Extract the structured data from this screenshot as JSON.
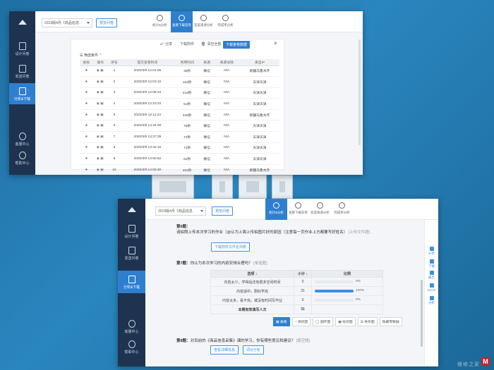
{
  "window1": {
    "sidebar": [
      {
        "label": "",
        "icon": "home-icon"
      },
      {
        "label": "设计问卷",
        "icon": "edit-document-icon"
      },
      {
        "label": "发送问卷",
        "icon": "send-document-icon"
      },
      {
        "label": "分析&下载",
        "icon": "analysis-icon",
        "active": true
      },
      {
        "label": "客服中心",
        "icon": "headset-icon"
      },
      {
        "label": "帮助中心",
        "icon": "help-icon"
      }
    ],
    "survey_select": "2019版4月《商品信息",
    "preview_label": "预览问卷",
    "tabs": [
      {
        "label": "统计&分析",
        "icon": "chart-pie-icon"
      },
      {
        "label": "查看下载答卷",
        "icon": "download-icon",
        "active": true
      },
      {
        "label": "答案来源分析",
        "icon": "source-icon"
      },
      {
        "label": "完成率分析",
        "icon": "check-circle-icon"
      }
    ],
    "toolbar": {
      "share": "分享",
      "download_attachment": "下载附件",
      "clear_all": "清空全部",
      "download_data": "下载答卷数据"
    },
    "filter_label": "筛选条件",
    "columns": [
      "星标",
      "操作",
      "序号",
      "提交答卷时间",
      "所用时间",
      "来源",
      "来源详情",
      "来自IP"
    ],
    "rows": [
      {
        "no": "1",
        "time": "2020/3/9 12:01:06",
        "dur": "36秒",
        "src": "微信",
        "detail": "N/A",
        "ip": "新疆乌鲁木齐"
      },
      {
        "no": "2",
        "time": "2020/3/9 12:03:10",
        "dur": "154秒",
        "src": "微信",
        "detail": "N/A",
        "ip": "天津天津"
      },
      {
        "no": "3",
        "time": "2020/3/9 12:08:34",
        "dur": "216秒",
        "src": "微信",
        "detail": "N/A",
        "ip": "天津天津"
      },
      {
        "no": "4",
        "time": "2020/3/9 12:10:33",
        "dur": "51秒",
        "src": "微信",
        "detail": "N/A",
        "ip": "天津天津"
      },
      {
        "no": "5",
        "time": "2020/3/9 12:11:24",
        "dur": "339秒",
        "src": "微信",
        "detail": "N/A",
        "ip": "新疆乌鲁木齐"
      },
      {
        "no": "6",
        "time": "2020/3/9 13:34:36",
        "dur": "75秒",
        "src": "微信",
        "detail": "N/A",
        "ip": "天津天津"
      },
      {
        "no": "7",
        "time": "2020/3/9 13:37:39",
        "dur": "72秒",
        "src": "微信",
        "detail": "N/A",
        "ip": "天津天津"
      },
      {
        "no": "8",
        "time": "2020/3/9 13:42:16",
        "dur": "71秒",
        "src": "微信",
        "detail": "N/A",
        "ip": "天津天津"
      },
      {
        "no": "9",
        "time": "2020/3/9 13:50:52",
        "dur": "62秒",
        "src": "微信",
        "detail": "N/A",
        "ip": "天津天津"
      },
      {
        "no": "10",
        "time": "2020/3/9 14:03:30",
        "dur": "401秒",
        "src": "微信",
        "detail": "N/A",
        "ip": "新疆乌鲁木齐"
      }
    ]
  },
  "window2": {
    "sidebar": [
      {
        "label": "",
        "icon": "home-icon"
      },
      {
        "label": "设计问卷",
        "icon": "edit-document-icon"
      },
      {
        "label": "发送问卷",
        "icon": "send-document-icon"
      },
      {
        "label": "分析&下载",
        "icon": "analysis-icon",
        "active": true
      },
      {
        "label": "客服中心",
        "icon": "headset-icon"
      },
      {
        "label": "帮助中心",
        "icon": "help-icon"
      }
    ],
    "survey_select": "2019版4月《商品信息",
    "preview_label": "预览问卷",
    "tabs": [
      {
        "label": "统计&分析",
        "icon": "chart-pie-icon",
        "active": true
      },
      {
        "label": "查看下载答卷",
        "icon": "download-icon"
      },
      {
        "label": "答案来源分析",
        "icon": "source-icon"
      },
      {
        "label": "完成率分析",
        "icon": "check-circle-icon"
      }
    ],
    "q6_title": "第6题：",
    "q6_text": "请拍照上传本次学习的作业（@认为上面上传拍图片好的原因（注意每一页作业上方都要写好姓名）",
    "q6_hint": "[上传文件题]",
    "q6_button": "下载附件文件名列表",
    "q7_title": "第7题：",
    "q7_text": "你认为本次学习的内容安排合理吗？",
    "q7_hint": "[单选题]",
    "table_headers": [
      "选项",
      "小计",
      "比例"
    ],
    "options": [
      {
        "label": "内容太少，学得后还有很多空闲时间",
        "count": "0",
        "pct": "0%",
        "ratio": 0
      },
      {
        "label": "内容适中，刚好学完",
        "count": "31",
        "pct": "100%",
        "ratio": 1
      },
      {
        "label": "内容太多，看不完，或没有时间写作业",
        "count": "0",
        "pct": "0%",
        "ratio": 0
      }
    ],
    "total_label": "本题有效填写人次",
    "total_value": "31",
    "view_buttons": [
      "表格",
      "饼状图",
      "圆环图",
      "柱状图",
      "条形图",
      "隐藏零数据"
    ],
    "q8_title": "第8题：",
    "q8_text": "对目前的《商品信息采集》课的学习，你有哪些意见和建议？",
    "q8_hint": "[填空题]",
    "q8_btn1": "查看详细信息",
    "q8_btn2": "词云分析",
    "right_rail": [
      "分享",
      "下载",
      "报告",
      "Excel",
      "分析"
    ]
  },
  "watermark": "维修之家"
}
